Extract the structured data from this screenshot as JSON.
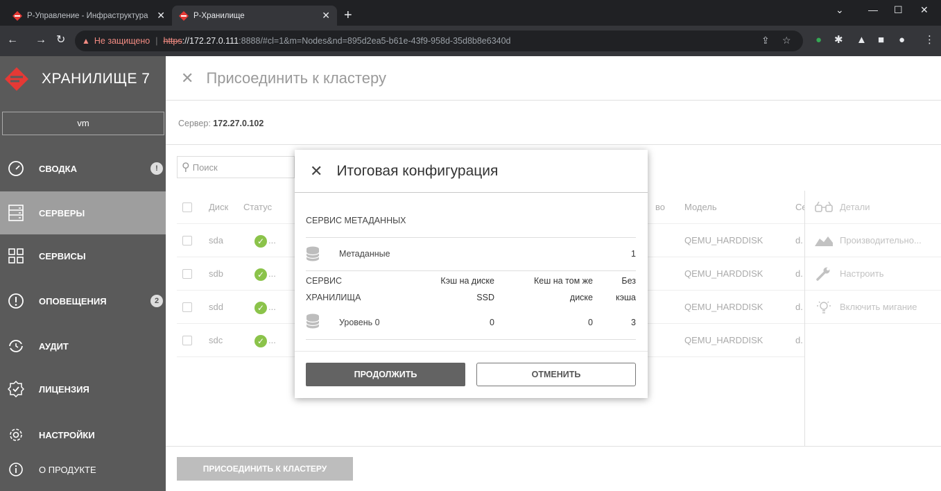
{
  "browser": {
    "tabs": [
      {
        "title": "Р-Управление - Инфраструктура"
      },
      {
        "title": "Р-Хранилище"
      }
    ],
    "new_tab": "+",
    "insecure_label": "Не защищено",
    "url_scheme": "https",
    "url_host": "://172.27.0.111",
    "url_rest": ":8888/#cl=1&m=Nodes&nd=895d2ea5-b61e-43f9-958d-35d8b8e6340d"
  },
  "sidebar": {
    "logo_text": "ХРАНИЛИЩЕ 7",
    "cluster": "vm",
    "items": [
      {
        "label": "СВОДКА",
        "icon": "gauge-icon",
        "badge": "!"
      },
      {
        "label": "СЕРВЕРЫ",
        "icon": "server-icon",
        "active": true
      },
      {
        "label": "СЕРВИСЫ",
        "icon": "grid-icon"
      },
      {
        "label": "ОПОВЕЩЕНИЯ",
        "icon": "alert-icon",
        "badge": "2"
      },
      {
        "label": "АУДИТ",
        "icon": "history-icon"
      },
      {
        "label": "ЛИЦЕНЗИЯ",
        "icon": "license-icon"
      },
      {
        "label": "НАСТРОЙКИ",
        "icon": "gear-icon"
      },
      {
        "label": "О ПРОДУКТЕ",
        "icon": "info-icon"
      }
    ]
  },
  "page": {
    "title": "Присоединить к кластеру",
    "server_label": "Сервер:",
    "server_value": "172.27.0.102",
    "search_placeholder": "Поиск",
    "columns": {
      "disk": "Диск",
      "status": "Статус",
      "type_trunc": "во",
      "model": "Модель",
      "serial_trunc": "Се"
    },
    "rows": [
      {
        "disk": "sda",
        "status": "...",
        "model": "QEMU_HARDDISK",
        "serial": "d."
      },
      {
        "disk": "sdb",
        "status": "...",
        "model": "QEMU_HARDDISK",
        "serial": "d."
      },
      {
        "disk": "sdd",
        "status": "...",
        "model": "QEMU_HARDDISK",
        "serial": "d."
      },
      {
        "disk": "sdc",
        "status": "...",
        "model": "QEMU_HARDDISK",
        "serial": "d."
      }
    ],
    "actions": [
      {
        "label": "Детали",
        "icon": "glasses-icon"
      },
      {
        "label": "Производительно...",
        "icon": "chart-icon"
      },
      {
        "label": "Настроить",
        "icon": "wrench-icon"
      },
      {
        "label": "Включить мигание",
        "icon": "bulb-icon"
      }
    ],
    "join_button": "ПРИСОЕДИНИТЬ К КЛАСТЕРУ"
  },
  "modal": {
    "title": "Итоговая конфигурация",
    "metadata_section": "СЕРВИС МЕТАДАННЫХ",
    "metadata_row": {
      "label": "Метаданные",
      "value": "1"
    },
    "storage_section_1": "СЕРВИС",
    "storage_section_2": "ХРАНИЛИЩА",
    "col_ssd_1": "Кэш на диске",
    "col_ssd_2": "SSD",
    "col_same_1": "Кеш на том же",
    "col_same_2": "диске",
    "col_none_1": "Без",
    "col_none_2": "кэша",
    "tier_row": {
      "label": "Уровень 0",
      "ssd": "0",
      "same": "0",
      "none": "3"
    },
    "continue_button": "ПРОДОЛЖИТЬ",
    "cancel_button": "ОТМЕНИТЬ"
  },
  "colors": {
    "brand": "#e53935",
    "sidebar": "#5a5a5a",
    "active_nav": "#9e9e9e",
    "ok": "#8bc34a"
  }
}
